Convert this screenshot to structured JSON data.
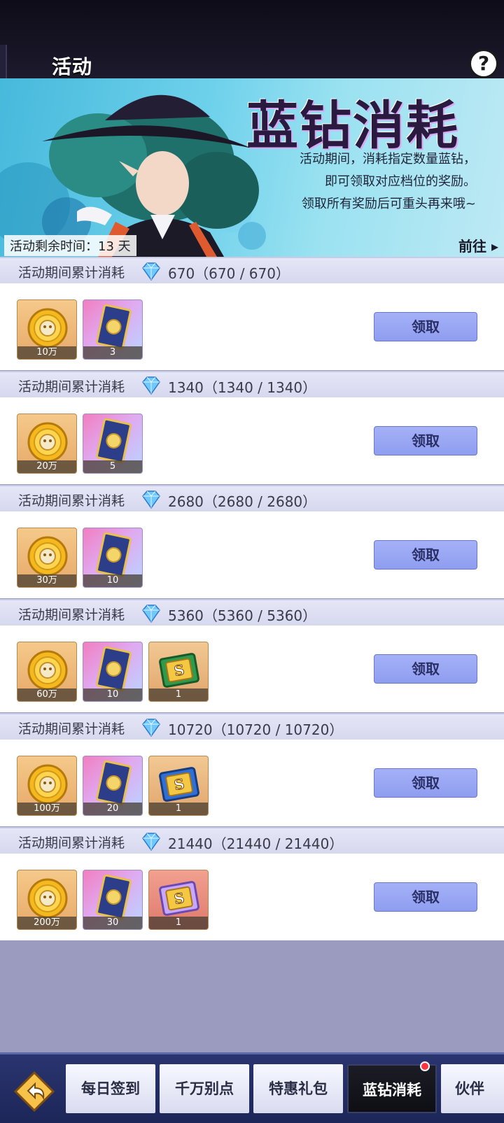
{
  "header": {
    "title": "活动",
    "help_label": "?"
  },
  "banner": {
    "title": "蓝钻消耗",
    "desc_lines": [
      "活动期间，消耗指定数量蓝钻，",
      "即可领取对应档位的奖励。",
      "领取所有奖励后可重头再来哦~"
    ],
    "remaining": "活动剩余时间：13 天",
    "goto_label": "前往"
  },
  "tiers": [
    {
      "label": "活动期间累计消耗",
      "value": "670（670 / 670）",
      "claim": "领取",
      "items": [
        {
          "type": "coin",
          "qty": "10万"
        },
        {
          "type": "card",
          "qty": "3"
        }
      ]
    },
    {
      "label": "活动期间累计消耗",
      "value": "1340（1340 / 1340）",
      "claim": "领取",
      "items": [
        {
          "type": "coin",
          "qty": "20万"
        },
        {
          "type": "card",
          "qty": "5"
        }
      ]
    },
    {
      "label": "活动期间累计消耗",
      "value": "2680（2680 / 2680）",
      "claim": "领取",
      "items": [
        {
          "type": "coin",
          "qty": "30万"
        },
        {
          "type": "card",
          "qty": "10"
        }
      ]
    },
    {
      "label": "活动期间累计消耗",
      "value": "5360（5360 / 5360）",
      "claim": "领取",
      "items": [
        {
          "type": "coin",
          "qty": "60万"
        },
        {
          "type": "card",
          "qty": "10"
        },
        {
          "type": "s-green",
          "qty": "1"
        }
      ]
    },
    {
      "label": "活动期间累计消耗",
      "value": "10720（10720 / 10720）",
      "claim": "领取",
      "items": [
        {
          "type": "coin",
          "qty": "100万"
        },
        {
          "type": "card",
          "qty": "20"
        },
        {
          "type": "s-blue",
          "qty": "1"
        }
      ]
    },
    {
      "label": "活动期间累计消耗",
      "value": "21440（21440 / 21440）",
      "claim": "领取",
      "items": [
        {
          "type": "coin",
          "qty": "200万"
        },
        {
          "type": "card",
          "qty": "30"
        },
        {
          "type": "s-rainbow",
          "qty": "1"
        }
      ]
    }
  ],
  "tabs": [
    {
      "label": "每日签到",
      "active": false
    },
    {
      "label": "千万别点",
      "active": false
    },
    {
      "label": "特惠礼包",
      "active": false
    },
    {
      "label": "蓝钻消耗",
      "active": true,
      "badge": true
    },
    {
      "label": "伙伴",
      "active": false
    }
  ],
  "icons": {
    "gem": "blue-diamond-icon",
    "coin": "gold-coin-icon",
    "card": "summon-card-icon",
    "back": "back-arrow-icon",
    "goto": "chevron-right-icon"
  },
  "colors": {
    "claim_button": "#98a6f3",
    "header_strip": "#dcdff2",
    "active_tab": "#111118",
    "badge": "#ff3342"
  }
}
